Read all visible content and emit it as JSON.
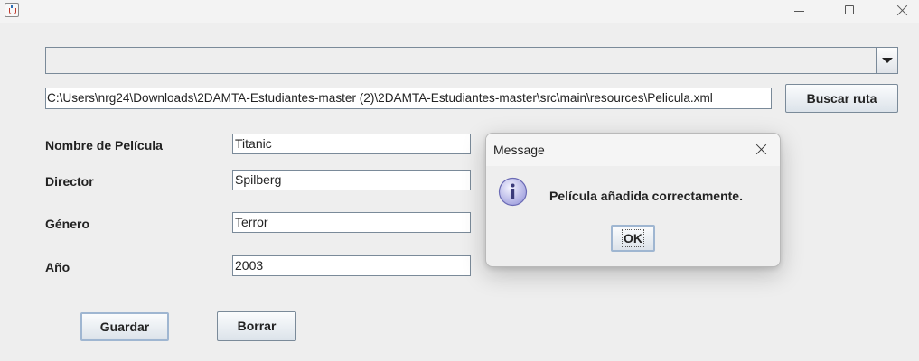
{
  "window": {
    "title": ""
  },
  "path_selector": {
    "combo_value": "",
    "path_value": "C:\\Users\\nrg24\\Downloads\\2DAMTA-Estudiantes-master (2)\\2DAMTA-Estudiantes-master\\src\\main\\resources\\Pelicula.xml",
    "browse_label": "Buscar ruta"
  },
  "form": {
    "fields": [
      {
        "label": "Nombre de Película",
        "value": "Titanic"
      },
      {
        "label": "Director",
        "value": "Spilberg"
      },
      {
        "label": "Género",
        "value": "Terror"
      },
      {
        "label": "Año",
        "value": "2003"
      }
    ],
    "save_label": "Guardar",
    "clear_label": "Borrar"
  },
  "dialog": {
    "title": "Message",
    "icon": "info-icon",
    "message": "Película añadida correctamente.",
    "ok_label": "OK"
  },
  "colors": {
    "background": "#eeeeee",
    "border": "#7a8a99",
    "focus": "#9fb6d1",
    "info_icon": "#a6a6e0"
  }
}
